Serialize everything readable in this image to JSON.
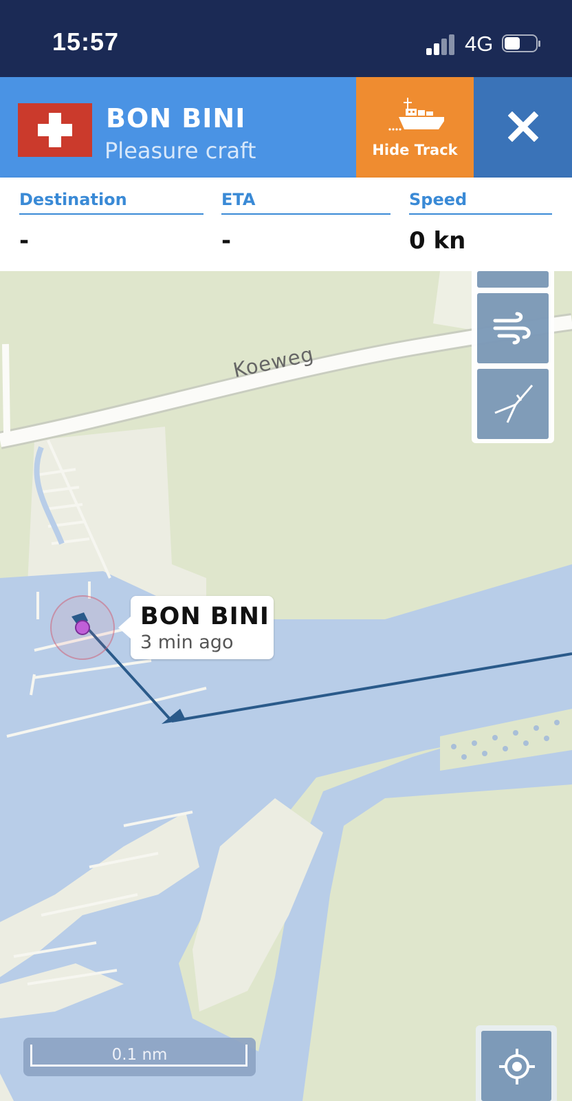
{
  "status_bar": {
    "time": "15:57",
    "network": "4G"
  },
  "vessel": {
    "name": "BON BINI",
    "type": "Pleasure craft",
    "flag_icon": "swiss-flag-icon",
    "hide_track_label": "Hide Track"
  },
  "info": {
    "destination_label": "Destination",
    "destination_value": "-",
    "eta_label": "ETA",
    "eta_value": "-",
    "speed_label": "Speed",
    "speed_value": "0 kn"
  },
  "map": {
    "road_label": "Koeweg",
    "vessel_label_name": "BON BINI",
    "vessel_label_time": "3 min ago",
    "scale_label": "0.1 nm",
    "tools": [
      "layers-icon",
      "wind-icon",
      "measure-compass-icon",
      "locate-icon"
    ]
  },
  "colors": {
    "status_bar": "#1b2a55",
    "header_blue": "#4a93e4",
    "hide_track_orange": "#ef8c30",
    "close_blue": "#3a73b8",
    "water": "#b8cde8",
    "land": "#dfe6cc",
    "track_line": "#2a5a8a",
    "vessel_dot": "#c05fd8"
  }
}
